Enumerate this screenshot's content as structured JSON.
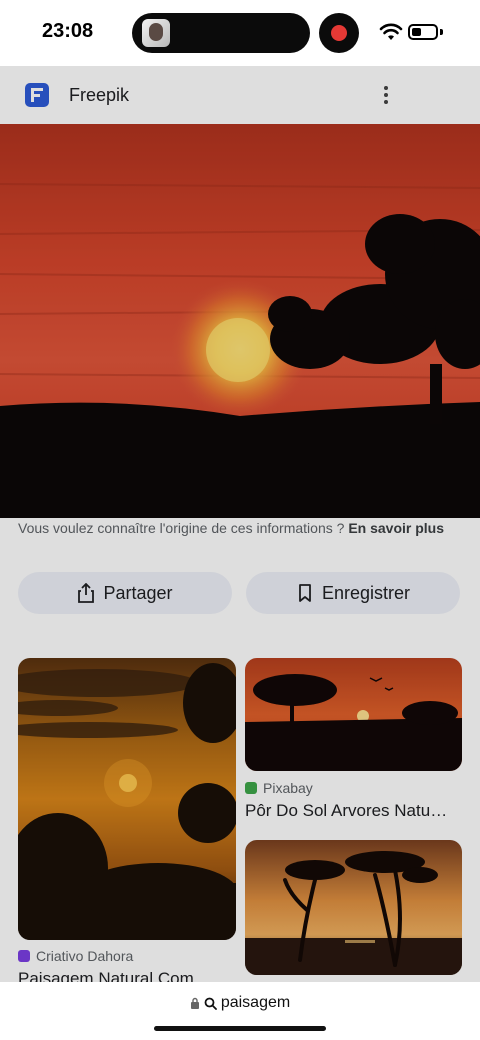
{
  "status_bar": {
    "time": "23:08",
    "battery_level": 0.3
  },
  "header": {
    "site_name": "Freepik",
    "more_icon": "more-vertical-icon"
  },
  "info": {
    "text": "Vous voulez connaître l'origine de ces informations ? ",
    "link": "En savoir plus"
  },
  "actions": {
    "share_label": "Partager",
    "save_label": "Enregistrer",
    "share_icon": "share-icon",
    "save_icon": "bookmark-icon"
  },
  "related": [
    {
      "source": "Criativo Dahora",
      "title": "Paisagem Natural Com",
      "source_color": "#7b3fe4"
    },
    {
      "source": "Pixabay",
      "title": "Pôr Do Sol Arvores Natu…",
      "source_color": "#3fa74a"
    },
    {
      "source": "",
      "title": ""
    }
  ],
  "browser": {
    "url": "paisagem",
    "lock_icon": "lock-icon",
    "search_icon": "search-icon"
  }
}
